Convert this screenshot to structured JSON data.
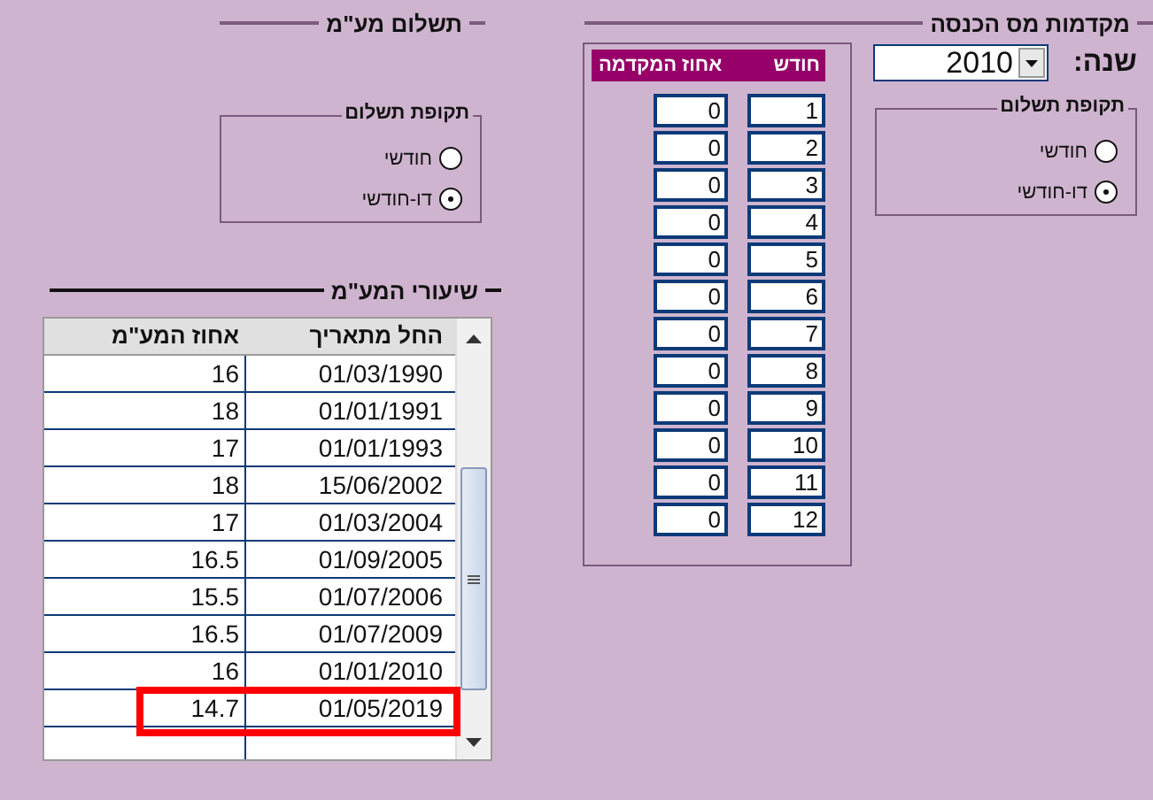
{
  "vat_payment": {
    "title": "תשלום מע\"מ",
    "payment_period": {
      "title": "תקופת תשלום",
      "options": [
        {
          "label": "חודשי",
          "selected": false
        },
        {
          "label": "דו-חודשי",
          "selected": true
        }
      ]
    },
    "vat_rates": {
      "title": "שיעורי המע\"מ",
      "columns": [
        "החל מתאריך",
        "אחוז המע\"מ"
      ],
      "rows": [
        {
          "start_date": "01/03/1990",
          "rate": "16",
          "highlighted": false
        },
        {
          "start_date": "01/01/1991",
          "rate": "18",
          "highlighted": false
        },
        {
          "start_date": "01/01/1993",
          "rate": "17",
          "highlighted": false
        },
        {
          "start_date": "15/06/2002",
          "rate": "18",
          "highlighted": false
        },
        {
          "start_date": "01/03/2004",
          "rate": "17",
          "highlighted": false
        },
        {
          "start_date": "01/09/2005",
          "rate": "16.5",
          "highlighted": false
        },
        {
          "start_date": "01/07/2006",
          "rate": "15.5",
          "highlighted": false
        },
        {
          "start_date": "01/07/2009",
          "rate": "16.5",
          "highlighted": false
        },
        {
          "start_date": "01/01/2010",
          "rate": "16",
          "highlighted": false
        },
        {
          "start_date": "01/05/2019",
          "rate": "14.7",
          "highlighted": true
        }
      ]
    }
  },
  "income_tax_advances": {
    "title": "מקדמות מס הכנסה",
    "year_label": "שנה:",
    "year": "2010",
    "payment_period": {
      "title": "תקופת תשלום",
      "options": [
        {
          "label": "חודשי",
          "selected": false
        },
        {
          "label": "דו-חודשי",
          "selected": true
        }
      ]
    },
    "advances_table": {
      "columns": [
        "חודש",
        "אחוז המקדמה"
      ],
      "rows": [
        {
          "month": "1",
          "percent": "0"
        },
        {
          "month": "2",
          "percent": "0"
        },
        {
          "month": "3",
          "percent": "0"
        },
        {
          "month": "4",
          "percent": "0"
        },
        {
          "month": "5",
          "percent": "0"
        },
        {
          "month": "6",
          "percent": "0"
        },
        {
          "month": "7",
          "percent": "0"
        },
        {
          "month": "8",
          "percent": "0"
        },
        {
          "month": "9",
          "percent": "0"
        },
        {
          "month": "10",
          "percent": "0"
        },
        {
          "month": "11",
          "percent": "0"
        },
        {
          "month": "12",
          "percent": "0"
        }
      ]
    }
  }
}
